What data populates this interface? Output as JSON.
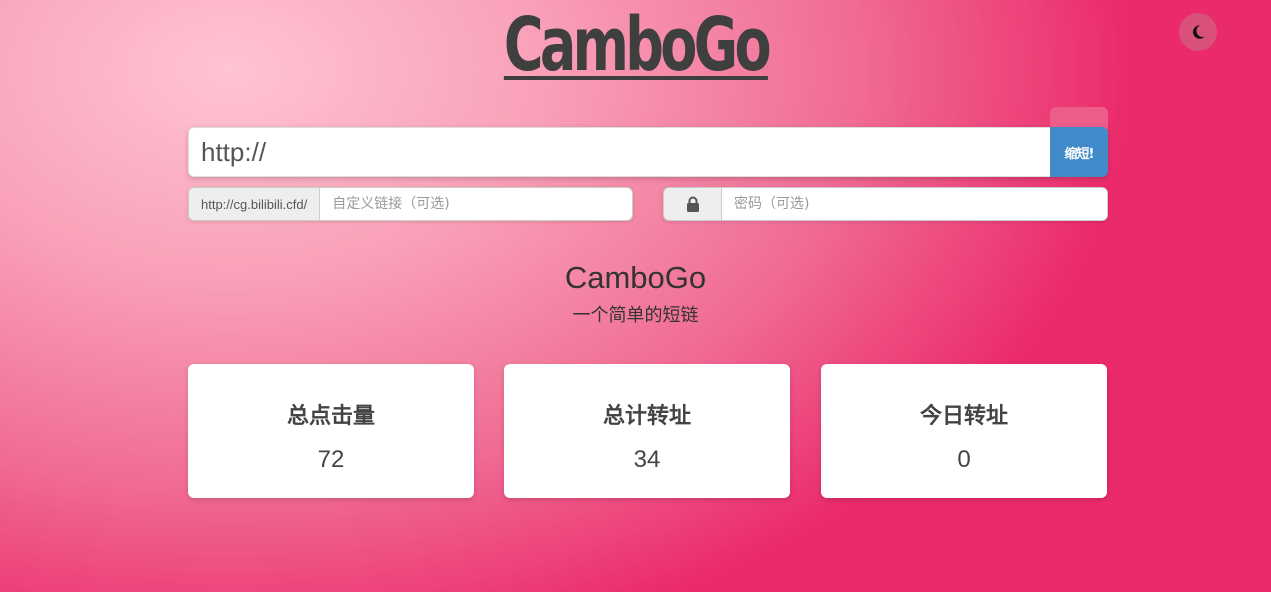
{
  "app": {
    "logo": "CamboGo",
    "brand_name": "CamboGo",
    "tagline": "一个简单的短链"
  },
  "theme_toggle": {
    "icon": "moon-icon"
  },
  "shorten": {
    "url_value": "http://",
    "button_label": "缩短!"
  },
  "custom_link": {
    "prefix": "http://cg.bilibili.cfd/",
    "placeholder": "自定义链接（可选)"
  },
  "password": {
    "icon": "lock-icon",
    "placeholder": "密码（可选)"
  },
  "stats": [
    {
      "title": "总点击量",
      "value": "72"
    },
    {
      "title": "总计转址",
      "value": "34"
    },
    {
      "title": "今日转址",
      "value": "0"
    }
  ],
  "colors": {
    "accent": "#428bca",
    "background_start": "#ffc4d2",
    "background_end": "#eb2a6b"
  }
}
